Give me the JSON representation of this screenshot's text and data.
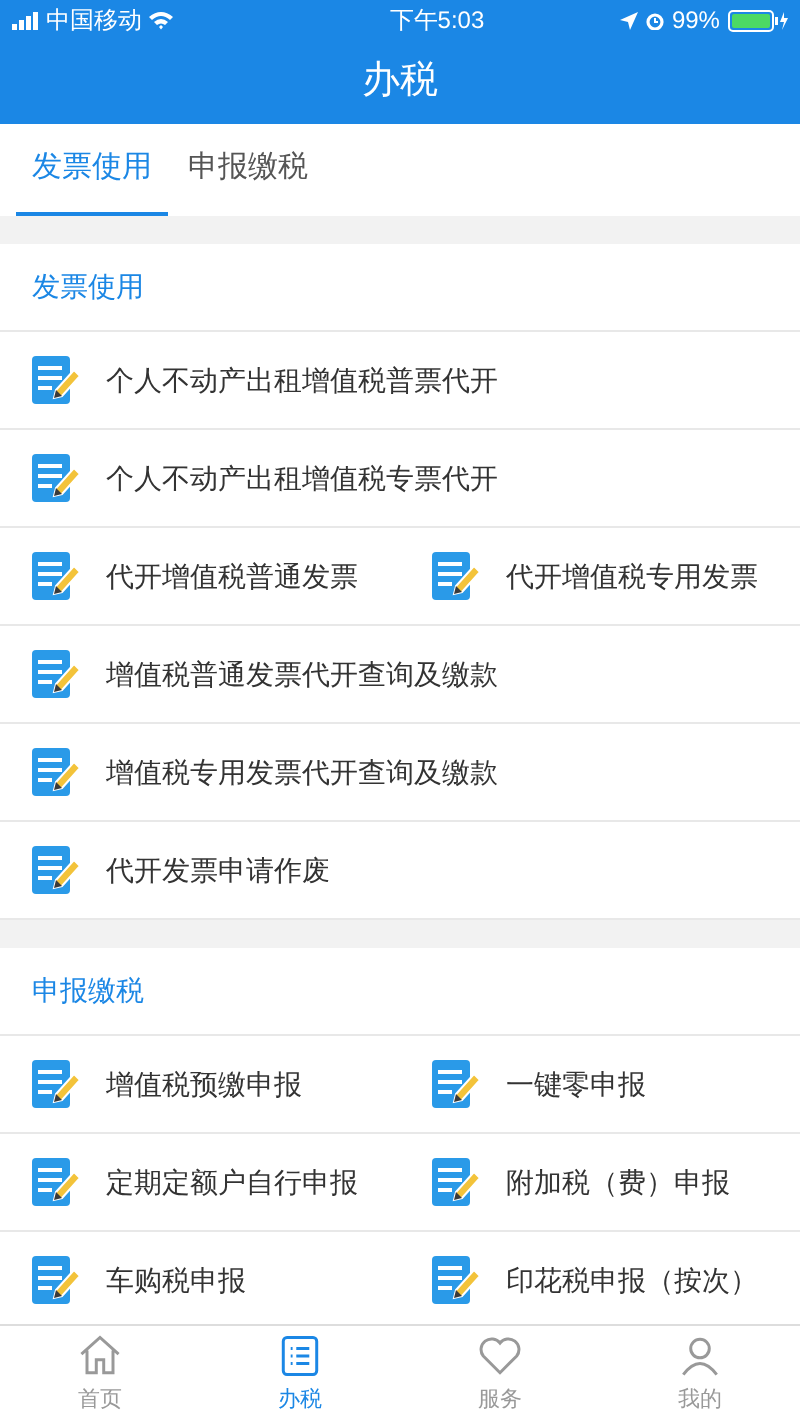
{
  "status_bar": {
    "carrier": "中国移动",
    "time": "下午5:03",
    "battery": "99%"
  },
  "header": {
    "title": "办税"
  },
  "tabs": [
    {
      "label": "发票使用",
      "selected": true
    },
    {
      "label": "申报缴税",
      "selected": false
    }
  ],
  "sections": [
    {
      "title": "发票使用",
      "rows": [
        [
          "个人不动产出租增值税普票代开"
        ],
        [
          "个人不动产出租增值税专票代开"
        ],
        [
          "代开增值税普通发票",
          "代开增值税专用发票"
        ],
        [
          "增值税普通发票代开查询及缴款"
        ],
        [
          "增值税专用发票代开查询及缴款"
        ],
        [
          "代开发票申请作废"
        ]
      ]
    },
    {
      "title": "申报缴税",
      "rows": [
        [
          "增值税预缴申报",
          "一键零申报"
        ],
        [
          "定期定额户自行申报",
          "附加税（费）申报"
        ],
        [
          "车购税申报",
          "印花税申报（按次）"
        ]
      ]
    }
  ],
  "bottom_nav": [
    {
      "label": "首页",
      "selected": false
    },
    {
      "label": "办税",
      "selected": true
    },
    {
      "label": "服务",
      "selected": false
    },
    {
      "label": "我的",
      "selected": false
    }
  ]
}
